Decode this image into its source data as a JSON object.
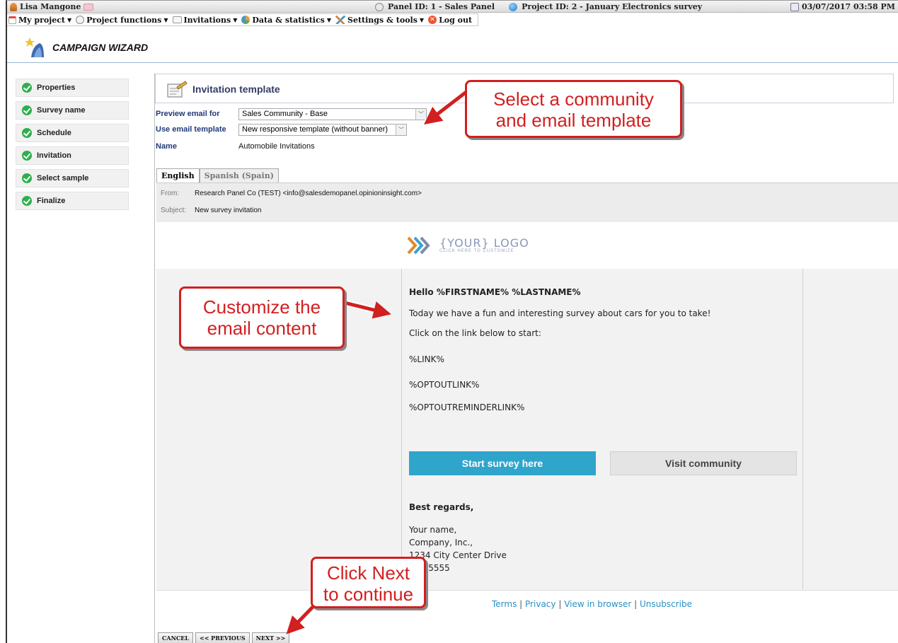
{
  "statusbar": {
    "user": "Lisa Mangone",
    "panel": "Panel ID: 1 - Sales Panel",
    "project": "Project ID: 2 - January Electronics survey",
    "datetime": "03/07/2017 03:58 PM"
  },
  "menu": {
    "items": [
      {
        "label": "My project",
        "icon": "home-icon"
      },
      {
        "label": "Project functions",
        "icon": "project-functions-icon"
      },
      {
        "label": "Invitations",
        "icon": "envelope-icon"
      },
      {
        "label": "Data & statistics",
        "icon": "chart-icon"
      },
      {
        "label": "Settings & tools",
        "icon": "tools-icon"
      },
      {
        "label": "Log out",
        "icon": "logout-icon"
      }
    ]
  },
  "wizard": {
    "title": "CAMPAIGN WIZARD"
  },
  "steps": [
    {
      "label": "Properties"
    },
    {
      "label": "Survey name"
    },
    {
      "label": "Schedule"
    },
    {
      "label": "Invitation"
    },
    {
      "label": "Select sample"
    },
    {
      "label": "Finalize"
    }
  ],
  "panel": {
    "title": "Invitation template"
  },
  "form": {
    "preview_label": "Preview email for",
    "preview_value": "Sales Community - Base",
    "template_label": "Use email template",
    "template_value": "New responsive template (without banner)",
    "name_label": "Name",
    "name_value": "Automobile Invitations"
  },
  "tabs": [
    {
      "label": "English",
      "active": true
    },
    {
      "label": "Spanish (Spain)",
      "active": false
    }
  ],
  "email_header": {
    "from_label": "From:",
    "from_value": "Research Panel Co (TEST) <info@salesdemopanel.opinioninsight.com>",
    "subject_label": "Subject:",
    "subject_value": "New survey invitation"
  },
  "email": {
    "logo_text": "{YOUR} LOGO",
    "logo_sub": "CLICK HERE TO CUSTOMIZE",
    "greeting": "Hello %FIRSTNAME% %LASTNAME%",
    "line1": "Today we have a fun and interesting survey about cars for you to take!",
    "line2": "Click on the link below to start:",
    "link": "%LINK%",
    "optout": "%OPTOUTLINK%",
    "optout_reminder": "%OPTOUTREMINDERLINK%",
    "start_button": "Start survey here",
    "visit_button": "Visit community",
    "regards": "Best regards,",
    "sig_name": "Your name,",
    "sig_company": "Company, Inc.,",
    "sig_address": "1234 City Center Drive",
    "sig_phone": "555-5555",
    "footer_terms": "Terms",
    "footer_privacy": "Privacy",
    "footer_view": "View in browser",
    "footer_unsub": "Unsubscribe",
    "sep": "|"
  },
  "bottom_buttons": {
    "cancel": "CANCEL",
    "previous": "<< PREVIOUS",
    "next": "NEXT >>"
  },
  "callouts": {
    "select": [
      "Select a community",
      "and email template"
    ],
    "customize": [
      "Customize the",
      "email content"
    ],
    "next": [
      "Click Next",
      "to continue"
    ]
  },
  "colors": {
    "callout_red": "#d21f1f",
    "start_button": "#2fa5cc",
    "check_green": "#2eae4e"
  }
}
